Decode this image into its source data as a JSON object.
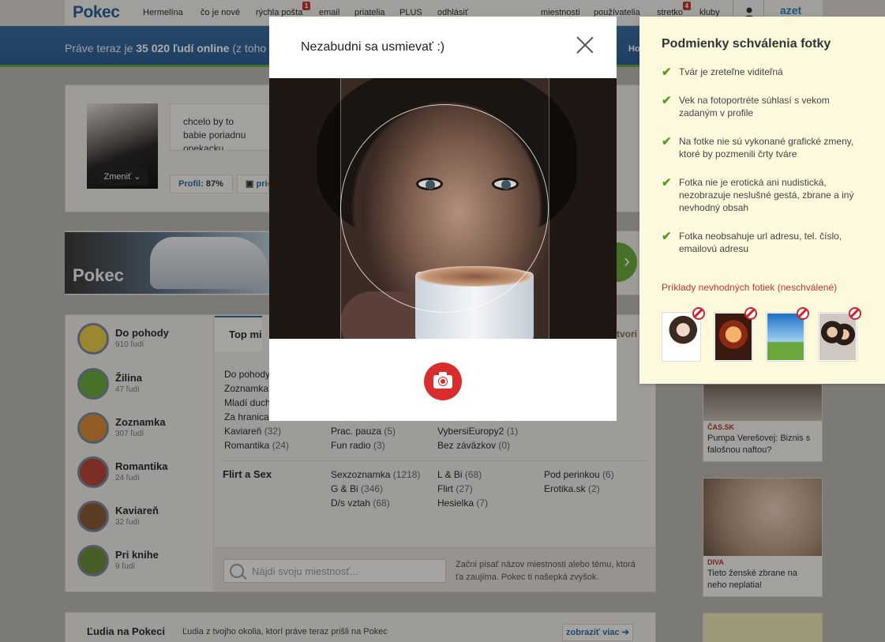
{
  "nav": {
    "logo": "Pokec",
    "items": [
      {
        "label": "Hermelína"
      },
      {
        "label": "čo je nové"
      },
      {
        "label": "rýchla pošta",
        "badge": "1"
      },
      {
        "label": "email"
      },
      {
        "label": "priatelia"
      },
      {
        "label": "PLUS"
      },
      {
        "label": "odhlásiť"
      },
      {
        "label": "miestnosti"
      },
      {
        "label": "používatelia"
      },
      {
        "label": "stretko",
        "badge": "4"
      },
      {
        "label": "kluby"
      }
    ],
    "azet": "azet"
  },
  "band": {
    "prefix": "Práve teraz je ",
    "count": "35 020 ľudí online",
    "suffix": " (z toho",
    "right_fragment": "Ho"
  },
  "profile": {
    "avatar_button": "Zmeniť",
    "status_text": "chcelo by to babie poriadnu opekacku",
    "profile_label": "Profil:",
    "profile_value": "87%",
    "second_btn": "prid"
  },
  "banner": {
    "logo": "Pokec"
  },
  "categories": [
    {
      "name": "Do pohody",
      "count": "910 ľudí",
      "color": "#e8c84a"
    },
    {
      "name": "Žilina",
      "count": "47 ľudí",
      "color": "#6aa73d"
    },
    {
      "name": "Zoznamka",
      "count": "307 ľudí",
      "color": "#d88a3a"
    },
    {
      "name": "Romantika",
      "count": "24 ľudí",
      "color": "#b8443a"
    },
    {
      "name": "Kaviareň",
      "count": "32 ľudí",
      "color": "#8a5a36"
    },
    {
      "name": "Pri knihe",
      "count": "9 ľudí",
      "color": "#6a8a3a"
    }
  ],
  "rooms": {
    "tab_label": "Top mie",
    "tab_right": "tvori",
    "col1": [
      {
        "name": "Do pohody",
        "n": ""
      },
      {
        "name": "Zoznamka",
        "n": ""
      },
      {
        "name": "Mladí duch",
        "n": ""
      },
      {
        "name": "Za hranica",
        "n": ""
      },
      {
        "name": "Kaviareň",
        "n": "(32)"
      },
      {
        "name": "Romantika",
        "n": "(24)"
      }
    ],
    "col2": [
      {
        "name": "Prac. pauza",
        "n": "(5)"
      },
      {
        "name": "Fun radio",
        "n": "(3)"
      }
    ],
    "col3": [
      {
        "name": "VybersiEuropy2",
        "n": "(1)"
      },
      {
        "name": "Bez záväzkov",
        "n": "(0)"
      }
    ],
    "flirt_title": "Flirt a Sex",
    "flirt": [
      {
        "name": "Sexzoznamka",
        "n": "(1218)"
      },
      {
        "name": "L & Bi",
        "n": "(68)"
      },
      {
        "name": "Pod perinkou",
        "n": "(6)"
      },
      {
        "name": "G & Bi",
        "n": "(346)"
      },
      {
        "name": "Flirt",
        "n": "(27)"
      },
      {
        "name": "Erotika.sk",
        "n": "(2)"
      },
      {
        "name": "D/s vztah",
        "n": "(68)"
      },
      {
        "name": "Hesielka",
        "n": "(7)"
      }
    ],
    "search_placeholder": "Nájdi svoju miestnosť...",
    "search_hint": "Začni písať názov miestnosti alebo tému, ktorá ťa zaujíma. Pokec ti našepká zvyšok."
  },
  "people": {
    "title": "Ľudia na Pokeci",
    "subtitle": "Ľudia z tvojho okolia, ktorí práve teraz prišli na Pokec",
    "show_more": "zobraziť viac"
  },
  "news": [
    {
      "tag": "ČAS.SK",
      "text": "Pumpa Verešovej: Biznis s falošnou naftou?"
    },
    {
      "tag": "DIVA",
      "text": "Tieto ženské zbrane na neho neplatia!"
    }
  ],
  "modal": {
    "title": "Nezabudni sa usmievať :)",
    "close_icon": "close-icon",
    "camera_icon": "camera-icon"
  },
  "rules": {
    "title": "Podmienky schválenia fotky",
    "items": [
      "Tvár je zreteľne viditeľná",
      "Vek na fotoportréte súhlasí s vekom zadaným v profile",
      "Na fotke nie sú vykonané grafické zmeny, ktoré by pozmenili črty tváre",
      "Fotka nie je erotická ani nudistická, nezobrazuje neslušné gestá, zbrane a iný nevhodný obsah",
      "Fotka neobsahuje url adresu, tel. číslo, emailovú adresu"
    ],
    "bad_title": "Príklady nevhodných fotiek (neschválené)"
  },
  "colors": {
    "accent_red": "#d92c2c",
    "rule_check": "#5b9a2a",
    "rules_bg": "#fdf9dc",
    "nav_blue": "#2b5f93"
  }
}
